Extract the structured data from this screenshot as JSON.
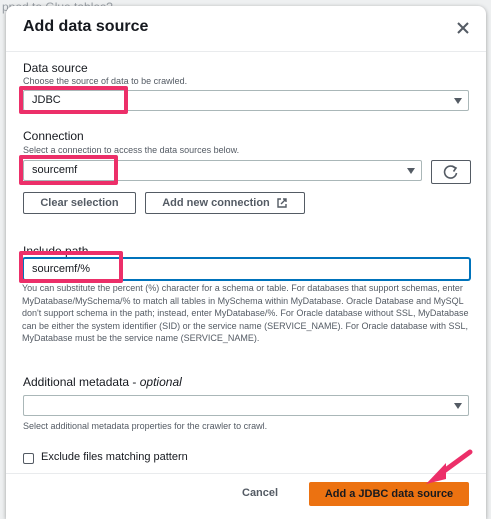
{
  "background": {
    "text": "pped to Glue tables?"
  },
  "modal": {
    "title": "Add data source"
  },
  "data_source": {
    "label": "Data source",
    "description": "Choose the source of data to be crawled.",
    "value": "JDBC"
  },
  "connection": {
    "label": "Connection",
    "description": "Select a connection to access the data sources below.",
    "value": "sourcemf",
    "clear_label": "Clear selection",
    "add_label": "Add new connection"
  },
  "include_path": {
    "label": "Include path",
    "value": "sourcemf/%",
    "help": "You can substitute the percent (%) character for a schema or table. For databases that support schemas, enter MyDatabase/MySchema/% to match all tables in MySchema within MyDatabase. Oracle Database and MySQL don't support schema in the path; instead, enter MyDatabase/%. For Oracle database without SSL, MyDatabase can be either the system identifier (SID) or the service name (SERVICE_NAME). For Oracle database with SSL, MyDatabase must be the service name (SERVICE_NAME)."
  },
  "additional_metadata": {
    "label": "Additional metadata - ",
    "label_optional": "optional",
    "description": "Select additional metadata properties for the crawler to crawl.",
    "value": ""
  },
  "exclude": {
    "label": "Exclude files matching pattern",
    "checked": false
  },
  "footer": {
    "cancel_label": "Cancel",
    "submit_label": "Add a JDBC data source"
  },
  "colors": {
    "highlight": "#ec2f69",
    "primary": "#ec7211",
    "focus": "#0073bb"
  }
}
